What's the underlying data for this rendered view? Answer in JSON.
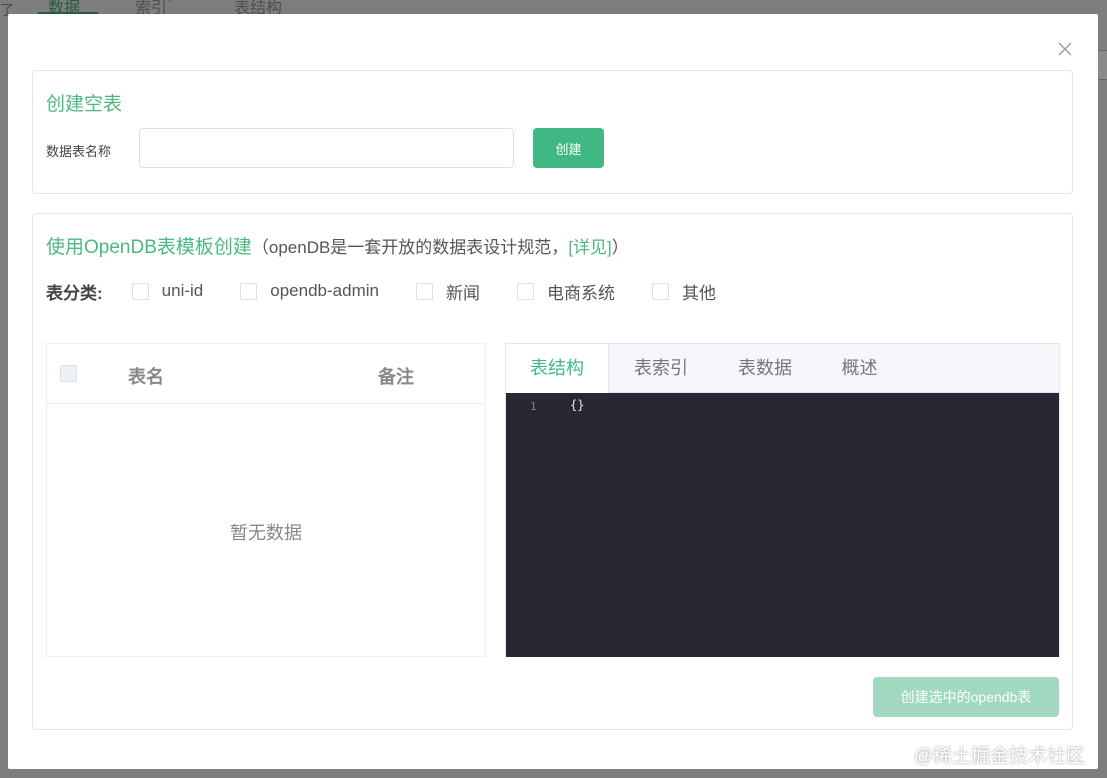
{
  "background": {
    "tabs": [
      "数据",
      "索引",
      "表结构"
    ],
    "tab_marker": "*",
    "edge_char": "了"
  },
  "dialog": {
    "create_empty": {
      "title": "创建空表",
      "name_label": "数据表名称",
      "name_value": "",
      "create_label": "创建"
    },
    "opendb": {
      "title": "使用OpenDB表模板创建",
      "subtitle": "（openDB是一套开放的数据表设计规范，",
      "link": "[详见]",
      "subtitle_end": "）",
      "category_label": "表分类:",
      "categories": [
        "uni-id",
        "opendb-admin",
        "新闻",
        "电商系统",
        "其他"
      ],
      "table": {
        "columns": [
          "表名",
          "备注"
        ],
        "empty_text": "暂无数据"
      },
      "tabs": [
        "表结构",
        "表索引",
        "表数据",
        "概述"
      ],
      "active_tab": "表结构",
      "editor": {
        "line_number": "1",
        "code": "{}"
      },
      "create_selected_label": "创建选中的opendb表"
    }
  },
  "watermark": "@稀土掘金技术社区",
  "colors": {
    "accent": "#41b883",
    "editor_bg": "#272833"
  }
}
